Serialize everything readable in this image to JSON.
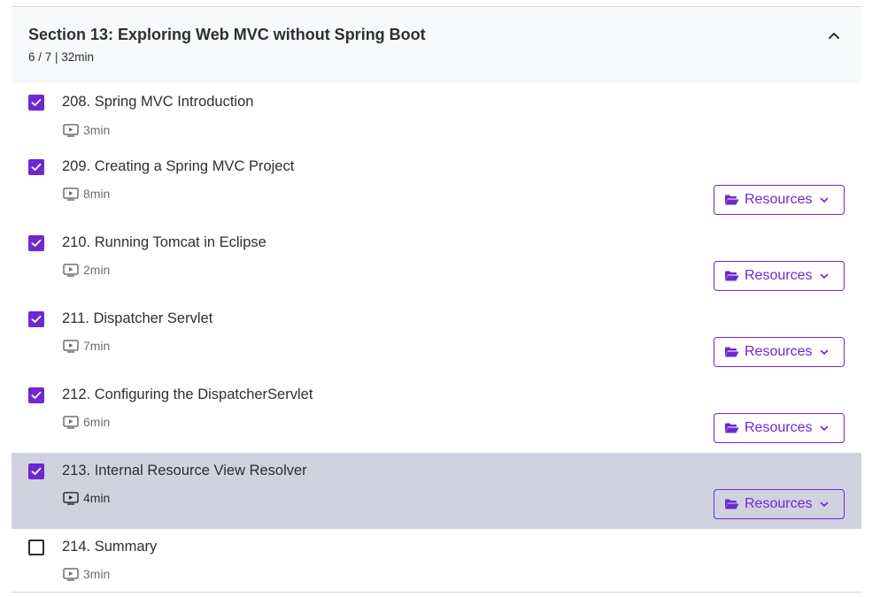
{
  "section": {
    "title": "Section 13: Exploring Web MVC without Spring Boot",
    "meta": "6 / 7 | 32min"
  },
  "lectures": [
    {
      "title": "208. Spring MVC Introduction",
      "duration": "3min",
      "checked": true,
      "has_resources": false,
      "active": false
    },
    {
      "title": "209. Creating a Spring MVC Project",
      "duration": "8min",
      "checked": true,
      "has_resources": true,
      "active": false
    },
    {
      "title": "210. Running Tomcat in Eclipse",
      "duration": "2min",
      "checked": true,
      "has_resources": true,
      "active": false
    },
    {
      "title": "211. Dispatcher Servlet",
      "duration": "7min",
      "checked": true,
      "has_resources": true,
      "active": false
    },
    {
      "title": "212. Configuring the DispatcherServlet",
      "duration": "6min",
      "checked": true,
      "has_resources": true,
      "active": false
    },
    {
      "title": "213. Internal Resource View Resolver",
      "duration": "4min",
      "checked": true,
      "has_resources": true,
      "active": true
    },
    {
      "title": "214. Summary",
      "duration": "3min",
      "checked": false,
      "has_resources": false,
      "active": false
    }
  ],
  "resources_label": "Resources",
  "icons": {
    "collapse": "chevron-up-icon",
    "checkbox": "checkmark-icon",
    "video": "video-icon",
    "folder": "folder-open-icon",
    "dropdown": "chevron-down-icon"
  },
  "colors": {
    "accent": "#6d28d2",
    "active_row": "#d1d2e0",
    "header_bg": "#f7f9fa",
    "text": "#2d2f31",
    "muted": "#6a6f73"
  }
}
